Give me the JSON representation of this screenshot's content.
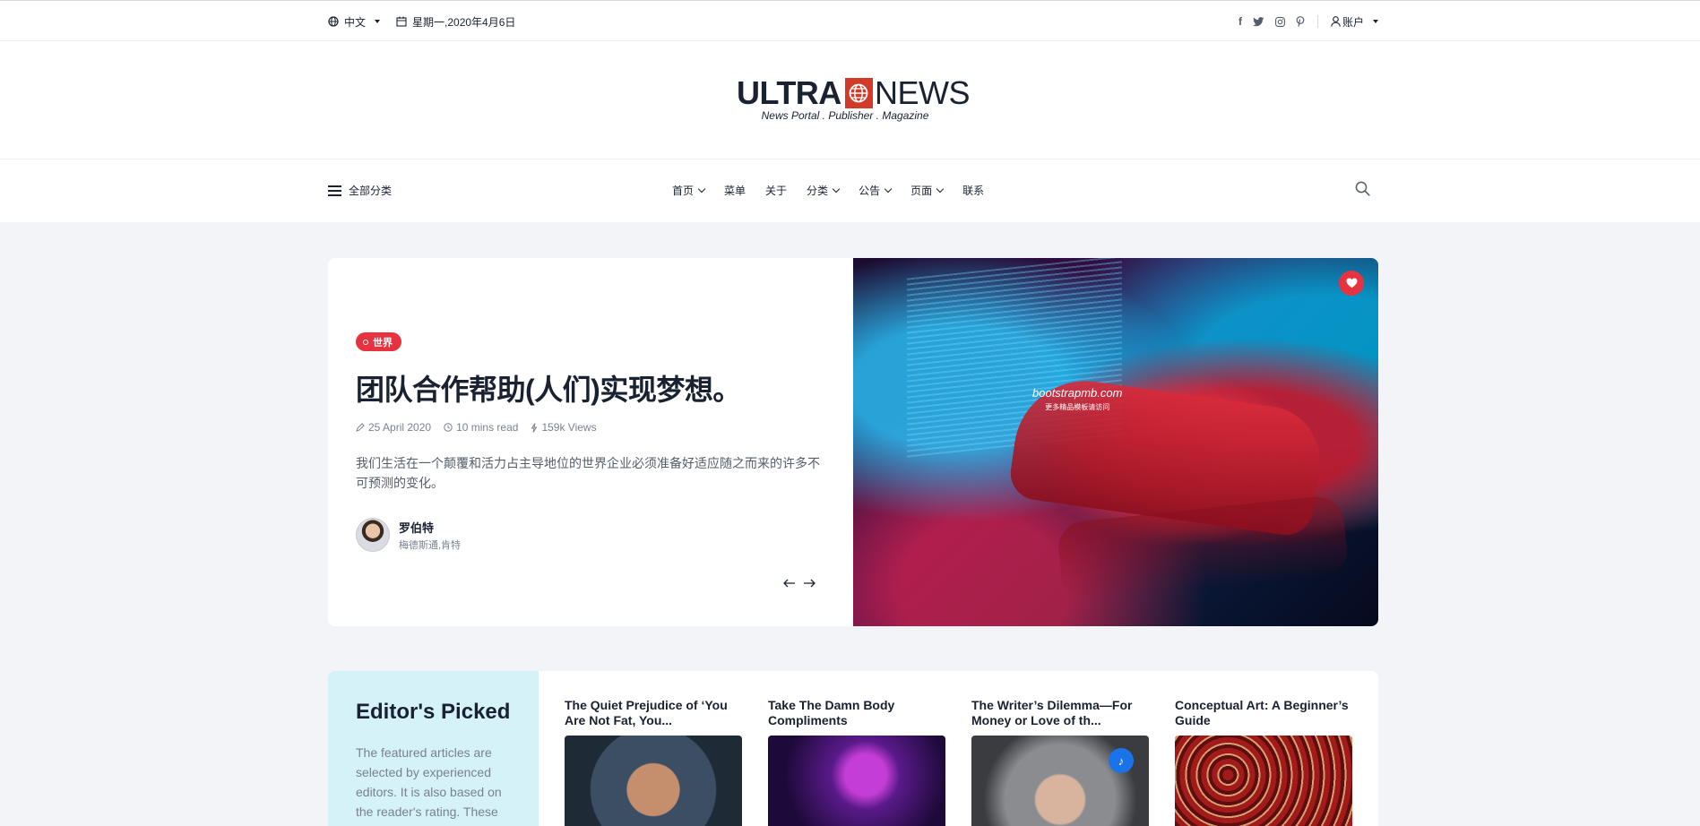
{
  "topbar": {
    "language": "中文",
    "date": "星期一,2020年4月6日",
    "social": [
      "f",
      "t",
      "ig",
      "p"
    ],
    "account": "账户"
  },
  "logo": {
    "ultra": "ULTRA",
    "news": "NEWS",
    "tagline": "News Portal . Publisher . Magazine"
  },
  "nav": {
    "all_categories": "全部分类",
    "items": [
      {
        "label": "首页",
        "dropdown": true
      },
      {
        "label": "菜单",
        "dropdown": false
      },
      {
        "label": "关于",
        "dropdown": false
      },
      {
        "label": "分类",
        "dropdown": true
      },
      {
        "label": "公告",
        "dropdown": true
      },
      {
        "label": "页面",
        "dropdown": true
      },
      {
        "label": "联系",
        "dropdown": false
      }
    ]
  },
  "hero": {
    "badge": "世界",
    "title": "团队合作帮助(人们)实现梦想。",
    "date": "25 April 2020",
    "read_time": "10 mins read",
    "views": "159k Views",
    "description": "我们生活在一个颠覆和活力占主导地位的世界企业必须准备好适应随之而来的许多不可预测的变化。",
    "author_name": "罗伯特",
    "author_role": "梅德斯通,肯特",
    "watermark": "bootstrapmb.com",
    "watermark_sub": "更多精品模板请访问"
  },
  "picked": {
    "title": "Editor's Picked",
    "description": "The featured articles are selected by experienced editors. It is also based on the reader's rating. These",
    "cards": [
      {
        "title": "The Quiet Prejudice of ‘You Are Not Fat, You..."
      },
      {
        "title": "Take The Damn Body Compliments"
      },
      {
        "title": "The Writer’s Dilemma—For Money or Love of th..."
      },
      {
        "title": "Conceptual Art: A Beginner’s Guide"
      }
    ]
  },
  "colors": {
    "accent_red": "#e6333f",
    "dark_text": "#1a2131",
    "picked_bg": "#d4f2f7",
    "music_blue": "#1a73e8"
  }
}
